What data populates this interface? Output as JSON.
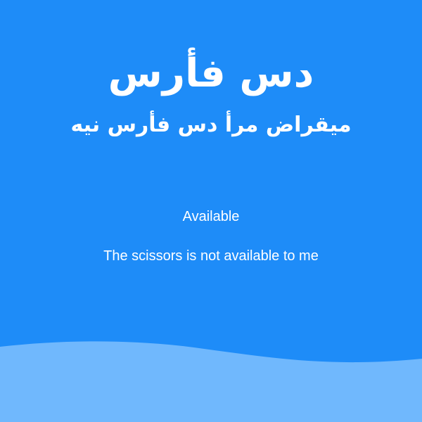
{
  "card": {
    "title": "دس فأرس",
    "subtitle": "ميقراض مرأ دس فأرس نيه",
    "status": "Available",
    "message": "The scissors is not available to me"
  },
  "colors": {
    "background": "#1e8cf8",
    "wave": "#70b8fd",
    "text": "#ffffff"
  }
}
